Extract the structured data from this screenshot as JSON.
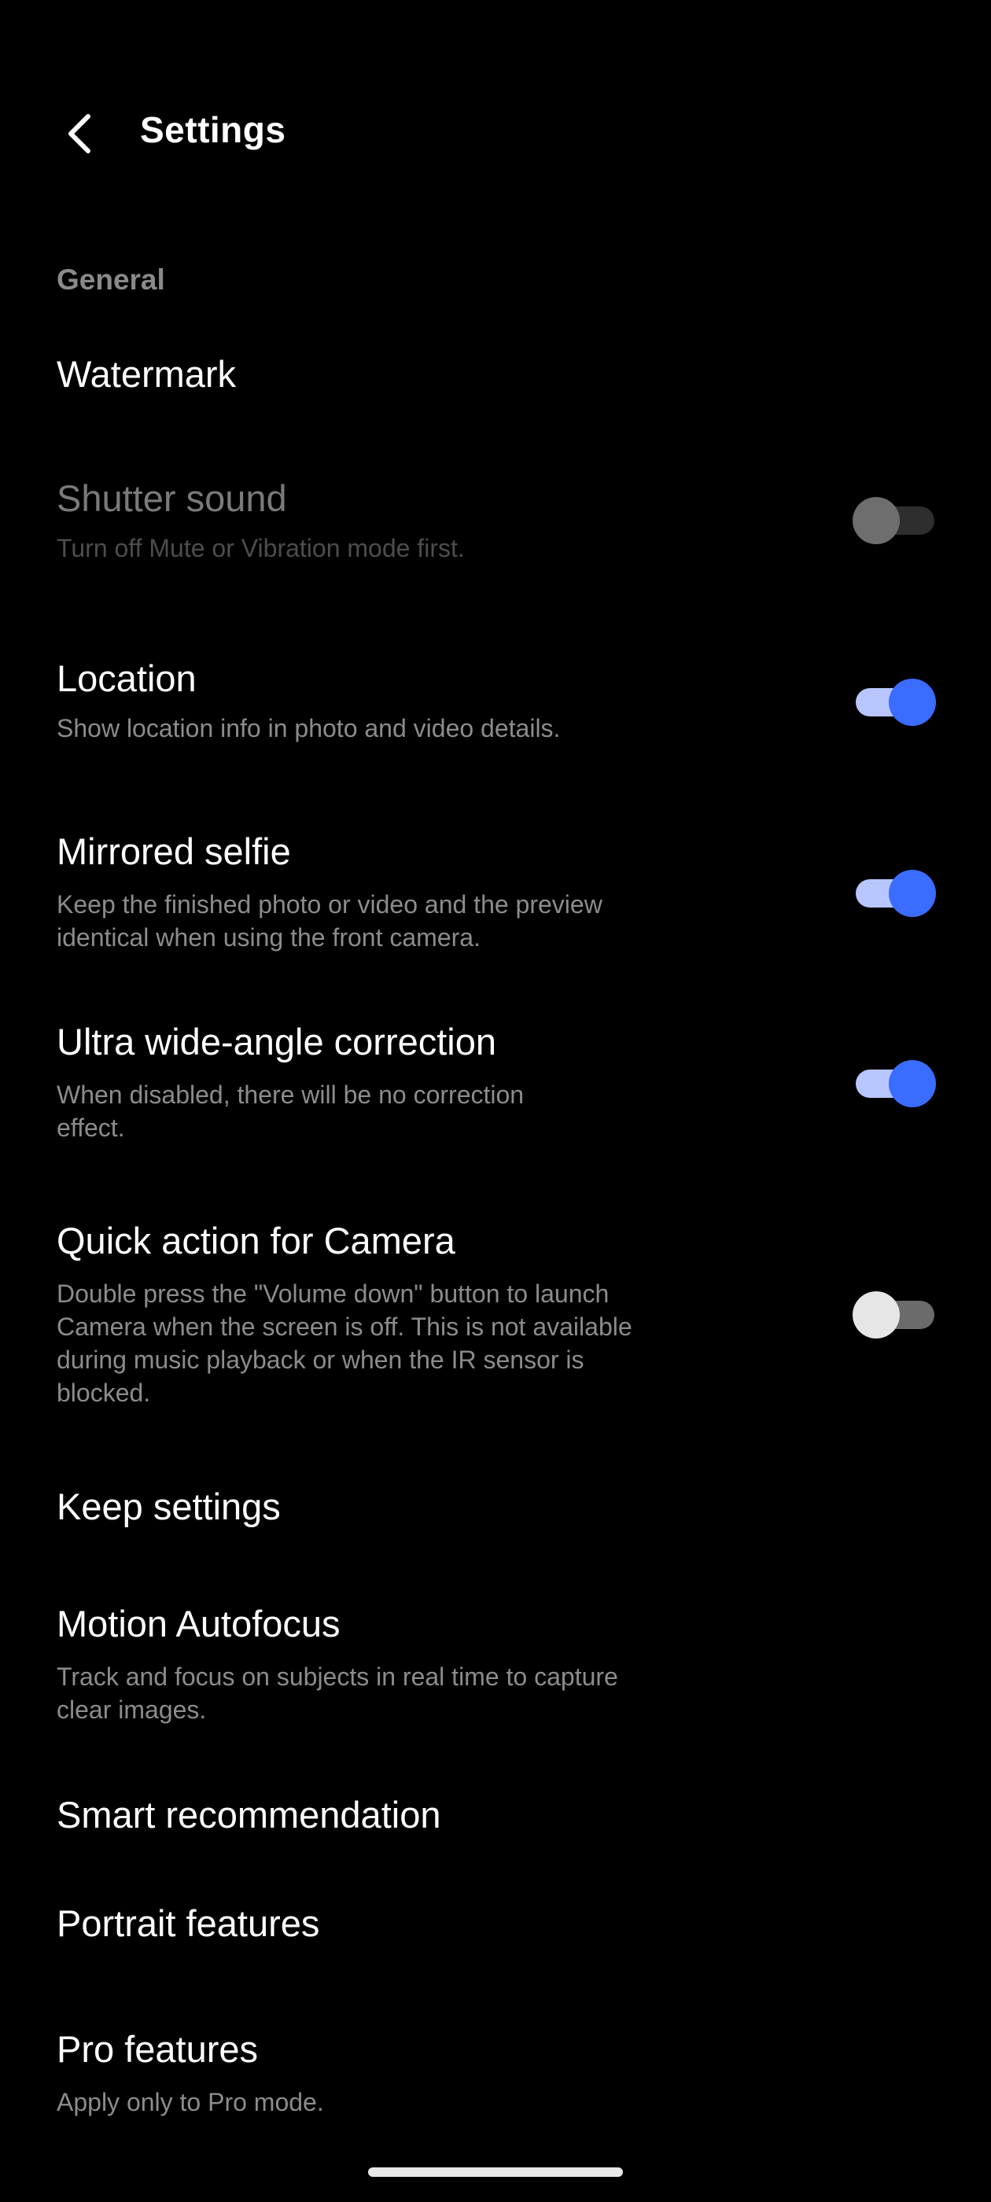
{
  "header": {
    "title": "Settings"
  },
  "general": {
    "section_title": "General",
    "watermark": {
      "title": "Watermark"
    },
    "shutter_sound": {
      "title": "Shutter sound",
      "subtitle": "Turn off Mute or Vibration mode first.",
      "enabled": false,
      "available": false
    },
    "location": {
      "title": "Location",
      "subtitle": "Show location info in photo and video details.",
      "enabled": true
    },
    "mirrored_selfie": {
      "title": "Mirrored selfie",
      "subtitle": "Keep the finished photo or video and the preview identical when using the front camera.",
      "enabled": true
    },
    "ultra_wide": {
      "title": "Ultra wide-angle correction",
      "subtitle": "When disabled, there will be no correction effect.",
      "enabled": true
    },
    "quick_action": {
      "title": "Quick action for Camera",
      "subtitle": "Double press the \"Volume down\" button to launch Camera when the screen is off. This is not available during music playback or when the IR sensor is blocked.",
      "enabled": false
    },
    "keep_settings": {
      "title": "Keep settings"
    },
    "motion_autofocus": {
      "title": "Motion Autofocus",
      "subtitle": "Track and focus on subjects in real time to capture clear images."
    },
    "smart_recommendation": {
      "title": "Smart recommendation"
    },
    "portrait_features": {
      "title": "Portrait features"
    },
    "pro_features": {
      "title": "Pro features",
      "subtitle": "Apply only to Pro mode."
    }
  },
  "colors": {
    "accent": "#3a6cff",
    "accent_track": "#b7c6ff",
    "background": "#000000"
  }
}
